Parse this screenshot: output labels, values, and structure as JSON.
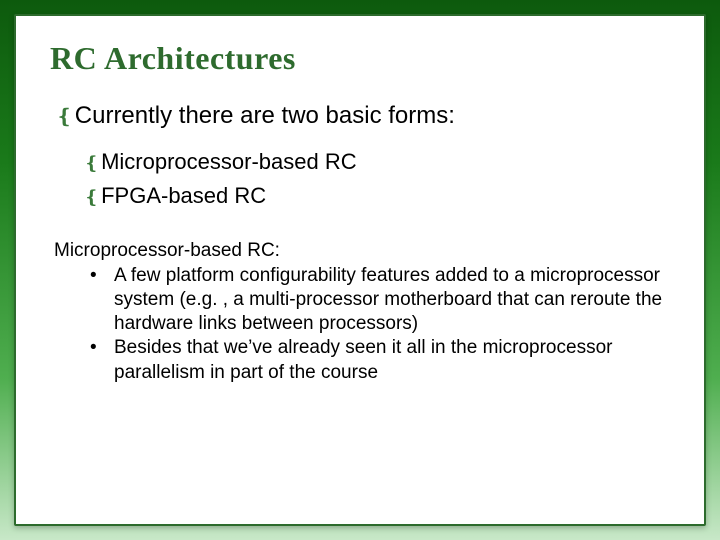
{
  "title": "RC Architectures",
  "lead": "Currently there are two basic forms:",
  "sub_items": [
    "Microprocessor-based RC",
    "FPGA-based RC"
  ],
  "body": {
    "heading": "Microprocessor-based RC:",
    "bullets": [
      " A few platform configurability features added to a microprocessor system (e.g. , a multi-processor motherboard that can reroute the hardware links between processors)",
      "Besides that we’ve already seen it all in the microprocessor parallelism in part of the course"
    ]
  }
}
